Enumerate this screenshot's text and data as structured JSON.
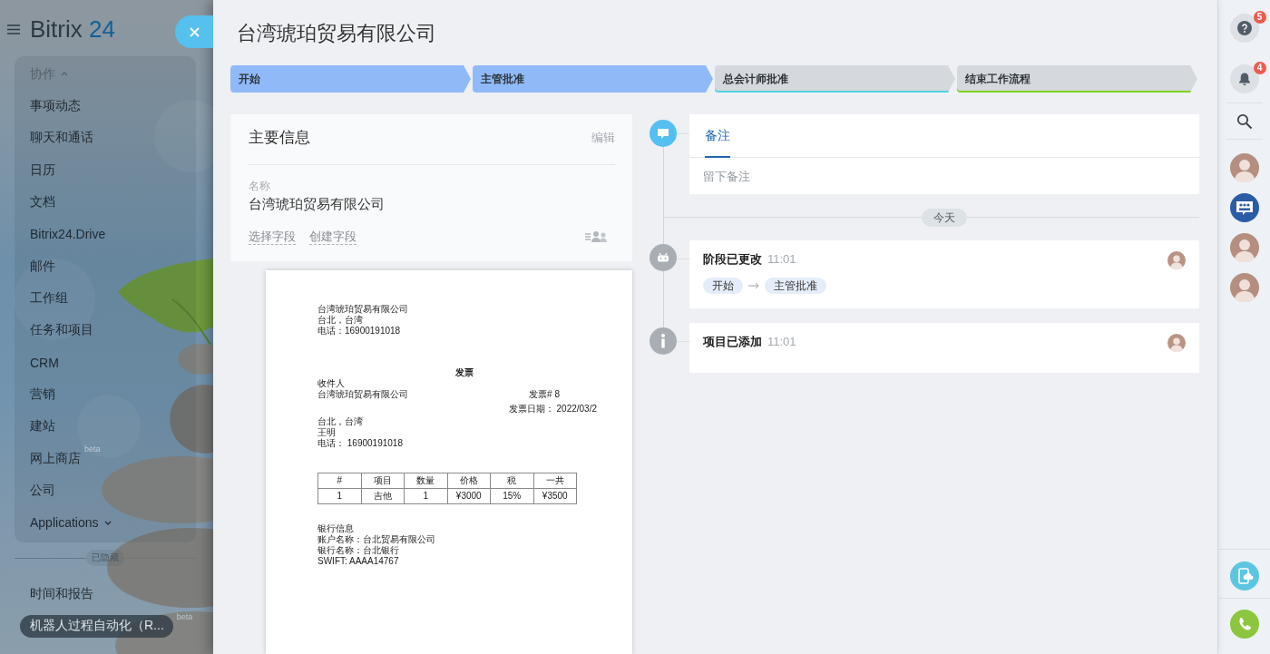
{
  "sidebar": {
    "logo": {
      "word": "Bitrix",
      "number": "24"
    },
    "section": {
      "label": "协作",
      "expanded": true
    },
    "items": [
      {
        "label": "事项动态",
        "kind": "link",
        "selected": false
      },
      {
        "label": "聊天和通话",
        "kind": "link",
        "selected": false
      },
      {
        "label": "日历",
        "kind": "link",
        "selected": false
      },
      {
        "label": "文档",
        "kind": "link",
        "selected": false
      },
      {
        "label": "Bitrix24.Drive",
        "kind": "link",
        "selected": false
      },
      {
        "label": "邮件",
        "kind": "link",
        "selected": false
      },
      {
        "label": "工作组",
        "kind": "link",
        "selected": false
      },
      {
        "label": "任务和项目",
        "kind": "link",
        "selected": false
      },
      {
        "label": "CRM",
        "kind": "link",
        "selected": false
      },
      {
        "label": "营销",
        "kind": "link",
        "selected": false
      },
      {
        "label": "建站",
        "kind": "link",
        "selected": false
      },
      {
        "label": "网上商店",
        "kind": "link",
        "selected": false,
        "badge": "beta"
      },
      {
        "label": "公司",
        "kind": "link",
        "selected": false
      },
      {
        "label": "Applications",
        "kind": "group",
        "selected": false,
        "expanded": false
      }
    ],
    "hidden_label": "已隐藏",
    "hidden_items": [
      {
        "label": "时间和报告",
        "kind": "link",
        "selected": false
      },
      {
        "label": "机器人过程自动化（R...",
        "kind": "link",
        "selected": true,
        "badge": "beta"
      }
    ]
  },
  "record": {
    "title": "台湾琥珀贸易有限公司",
    "stages": [
      {
        "label": "开始",
        "color": "#90b9f8",
        "reached": true
      },
      {
        "label": "主管批准",
        "color": "#90b9f8",
        "reached": true
      },
      {
        "label": "总会计师批准",
        "color": "#55d0e0",
        "reached": false
      },
      {
        "label": "结束工作流程",
        "color": "#7ed321",
        "reached": false
      }
    ]
  },
  "info_card": {
    "title": "主要信息",
    "action": "编辑",
    "fields": [
      {
        "label": "名称",
        "value": "台湾琥珀贸易有限公司"
      }
    ],
    "links": [
      "选择字段",
      "创建字段"
    ]
  },
  "document": {
    "sender": [
      "台湾琥珀贸易有限公司",
      "台北，台湾",
      "电话：16900191018"
    ],
    "heading": "发票",
    "recipient_label": "收件人",
    "recipient_name": "台湾琥珀贸易有限公司",
    "invoice_number": "发票# 8",
    "invoice_date": "发票日期： 2022/03/2",
    "recipient_lines": [
      "台北，台湾",
      "王明",
      "电话： 16900191018"
    ],
    "table": {
      "columns": [
        "#",
        "项目",
        "数量",
        "价格",
        "税",
        "一共"
      ],
      "rows": [
        [
          "1",
          "吉他",
          "1",
          "¥3000",
          "15%",
          "¥3500"
        ]
      ]
    },
    "bank": [
      "银行信息",
      "账户名称：台北贸易有限公司",
      "银行名称：台北银行",
      "SWIFT: AAAA14767"
    ]
  },
  "timeline": {
    "composer": {
      "tabs": [
        {
          "label": "备注",
          "selected": true
        }
      ],
      "placeholder": "留下备注"
    },
    "day_label": "今天",
    "events": [
      {
        "kind": "stage_change",
        "title": "阶段已更改",
        "time": "11:01",
        "from": "开始",
        "to": "主管批准"
      },
      {
        "kind": "item_added",
        "title": "项目已添加",
        "time": "11:01"
      }
    ]
  },
  "right_bar": {
    "buttons": [
      {
        "kind": "help",
        "count": "5"
      },
      {
        "kind": "notifications",
        "count": "4"
      }
    ],
    "contacts": [
      {
        "kind": "person"
      },
      {
        "kind": "group_chat"
      },
      {
        "kind": "person"
      },
      {
        "kind": "person"
      }
    ]
  }
}
